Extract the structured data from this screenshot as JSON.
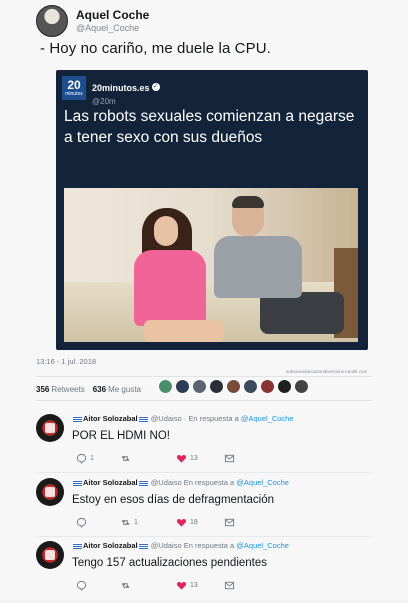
{
  "author": {
    "display_name": "Aquel Coche",
    "handle": "@Aquel_Coche"
  },
  "tweet": {
    "text": "- Hoy no cariño, me duele la CPU."
  },
  "quoted_card": {
    "logo_number": "20",
    "logo_word": "minutos",
    "source_name": "20minutos.es",
    "source_handle": "@20m",
    "headline": "Las robots sexuales comienzan a negarse a tener sexo con sus dueños"
  },
  "meta": {
    "timestamp": "13:16 - 1 jul. 2018",
    "credit": "sebanavidancastrudiversions.tumblr.com"
  },
  "stats": {
    "retweets_count": "356",
    "retweets_label": "Retweets",
    "likes_count": "636",
    "likes_label": "Me gusta"
  },
  "colors": {
    "accent": "#1b95e0",
    "card_bg": "#13243a",
    "like_red": "#e0245e"
  },
  "replies": [
    {
      "name": "Aitor Solozabal",
      "handle": "@Udaiso",
      "reply_prefix": "· En respuesta a",
      "reply_to": "@Aquel_Coche",
      "text": "POR EL HDMI NO!",
      "reply_count": "1",
      "retweet_count": "",
      "like_count": "13"
    },
    {
      "name": "Aitor Solozabal",
      "handle": "@Udaiso",
      "reply_prefix": "En respuesta a",
      "reply_to": "@Aquel_Coche",
      "text": "Estoy en esos días de defragmentación",
      "reply_count": "",
      "retweet_count": "1",
      "like_count": "18"
    },
    {
      "name": "Aitor Solozabal",
      "handle": "@Udaiso",
      "reply_prefix": "En respuesta a",
      "reply_to": "@Aquel_Coche",
      "text": "Tengo 157 actualizaciones pendientes",
      "reply_count": "",
      "retweet_count": "",
      "like_count": "13"
    }
  ]
}
